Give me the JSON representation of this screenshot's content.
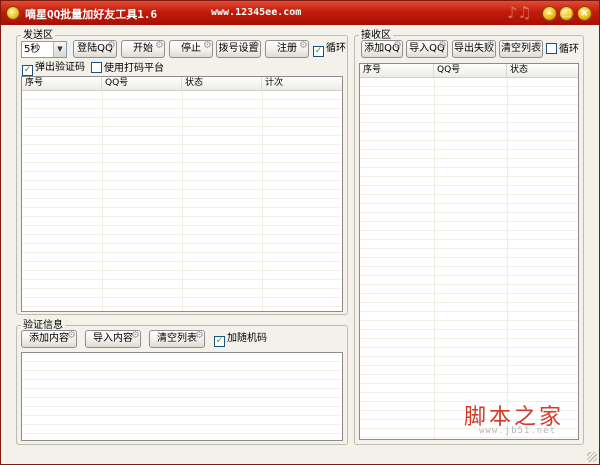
{
  "window": {
    "title": "嘀星QQ批量加好友工具1.6",
    "url": "www.12345ee.com",
    "deco": "♪♫"
  },
  "send_section": {
    "label": "发送区",
    "interval_value": "5秒",
    "buttons": {
      "login": "登陆QQ",
      "start": "开始",
      "stop": "停止",
      "dial": "拨号设置",
      "register": "注册"
    },
    "loop_label": "循环",
    "loop_checked": true,
    "popup_captcha_label": "弹出验证码",
    "popup_captcha_checked": true,
    "use_platform_label": "使用打码平台",
    "use_platform_checked": false,
    "columns": [
      "序号",
      "QQ号",
      "状态",
      "计次"
    ]
  },
  "verify_section": {
    "label": "验证信息",
    "buttons": {
      "add": "添加内容",
      "import": "导入内容",
      "clear": "清空列表"
    },
    "random_code_label": "加随机码",
    "random_code_checked": true
  },
  "receive_section": {
    "label": "接收区",
    "buttons": {
      "add_qq": "添加QQ",
      "import_qq": "导入QQ",
      "export_fail": "导出失败",
      "clear": "清空列表"
    },
    "loop_label": "循环",
    "loop_checked": false,
    "columns": [
      "序号",
      "QQ号",
      "状态"
    ]
  },
  "watermark": {
    "text": "脚本之家",
    "url": "www.jb51.net"
  },
  "icons": {
    "check_mark": "✓",
    "dropdown_arrow": "▼",
    "gear": "⚙"
  }
}
